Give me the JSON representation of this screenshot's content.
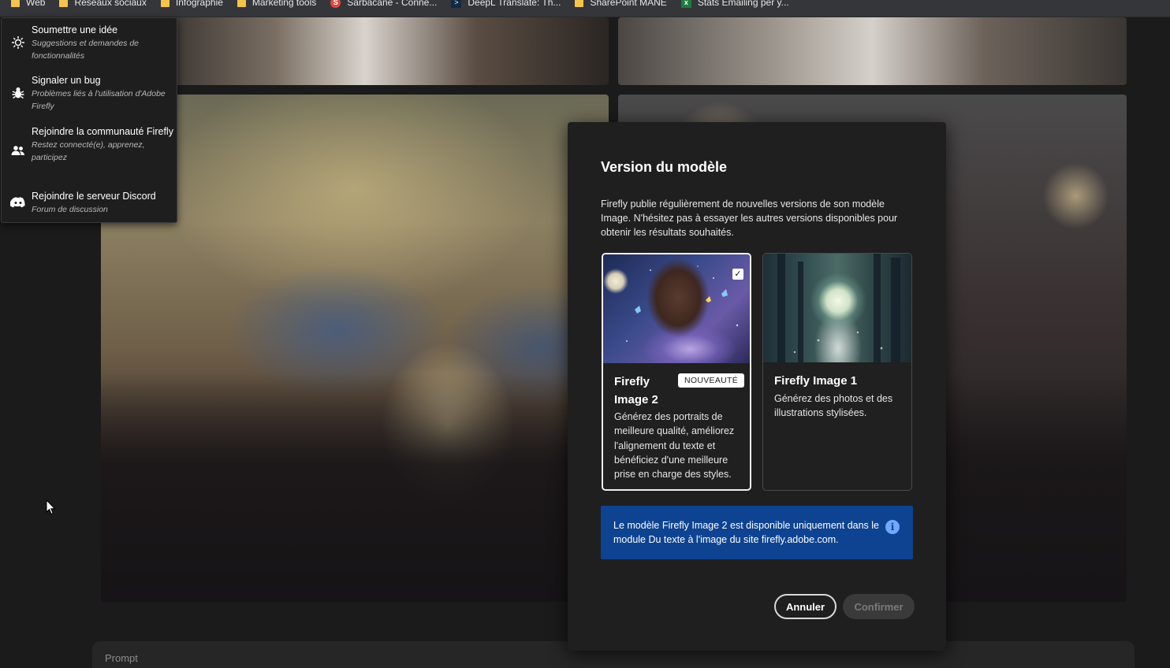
{
  "bookmarks": [
    {
      "label": "Web",
      "icon": "folder-icon"
    },
    {
      "label": "Reseaux sociaux",
      "icon": "folder-icon"
    },
    {
      "label": "Infographie",
      "icon": "folder-icon"
    },
    {
      "label": "Marketing tools",
      "icon": "folder-icon"
    },
    {
      "label": "Sarbacane - Conne...",
      "icon": "sarbacane-icon"
    },
    {
      "label": "DeepL Translate: Th...",
      "icon": "deepl-icon"
    },
    {
      "label": "SharePoint MANE",
      "icon": "folder-icon"
    },
    {
      "label": "Stats Emailing per y...",
      "icon": "excel-icon"
    }
  ],
  "help_menu": {
    "items": [
      {
        "title": "Soumettre une idée",
        "subtitle": "Suggestions et demandes de fonctionnalités",
        "icon": "lightbulb-icon"
      },
      {
        "title": "Signaler un bug",
        "subtitle": "Problèmes liés à l'utilisation d'Adobe Firefly",
        "icon": "bug-icon"
      },
      {
        "title": "Rejoindre la communauté Firefly",
        "subtitle": "Restez connecté(e), apprenez, participez",
        "icon": "community-icon"
      },
      {
        "title": "Rejoindre le serveur Discord",
        "subtitle": "Forum de discussion",
        "icon": "discord-icon"
      }
    ]
  },
  "dialog": {
    "title": "Version du modèle",
    "description": "Firefly publie régulièrement de nouvelles versions de son modèle Image. N'hésitez pas à essayer les autres versions disponibles pour obtenir les résultats souhaités.",
    "cards": [
      {
        "title": "Firefly Image 2",
        "badge": "NOUVEAUTÉ",
        "description": "Générez des portraits de meilleure qualité, améliorez l'alignement du texte et bénéficiez d'une meilleure prise en charge des styles.",
        "selected": true
      },
      {
        "title": "Firefly Image 1",
        "badge": "",
        "description": "Générez des photos et des illustrations stylisées.",
        "selected": false
      }
    ],
    "info": "Le modèle Firefly Image 2 est disponible uniquement dans le module Du texte à l'image du site firefly.adobe.com.",
    "cancel_label": "Annuler",
    "confirm_label": "Confirmer"
  },
  "prompt": {
    "label": "Prompt"
  },
  "colors": {
    "info_bg": "#0d4391",
    "dialog_bg": "#1f1f1f",
    "badge_bg": "#ffffff"
  }
}
